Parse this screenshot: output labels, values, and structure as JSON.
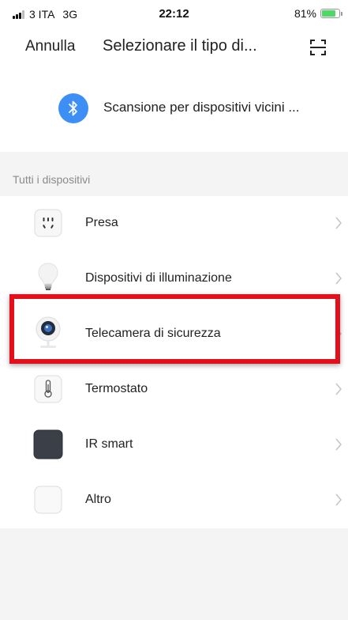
{
  "status_bar": {
    "carrier": "3 ITA",
    "network": "3G",
    "time": "22:12",
    "battery_percent": "81%",
    "battery_level": 0.81
  },
  "nav": {
    "cancel_label": "Annulla",
    "title": "Selezionare il tipo di...",
    "scan_icon": "qr-scan-icon"
  },
  "bluetooth_scan": {
    "label": "Scansione per dispositivi vicini ...",
    "icon": "bluetooth-icon",
    "icon_color": "#3d8ff5"
  },
  "section": {
    "label": "Tutti i dispositivi"
  },
  "devices": [
    {
      "label": "Presa",
      "icon": "socket-icon"
    },
    {
      "label": "Dispositivi di illuminazione",
      "icon": "light-bulb-icon"
    },
    {
      "label": "Telecamera di sicurezza",
      "icon": "security-camera-icon"
    },
    {
      "label": "Termostato",
      "icon": "thermostat-icon"
    },
    {
      "label": "IR smart",
      "icon": "ir-remote-icon"
    },
    {
      "label": "Altro",
      "icon": "other-device-icon"
    }
  ],
  "highlight": {
    "target": "Telecamera di sicurezza",
    "color": "#e3101b"
  }
}
